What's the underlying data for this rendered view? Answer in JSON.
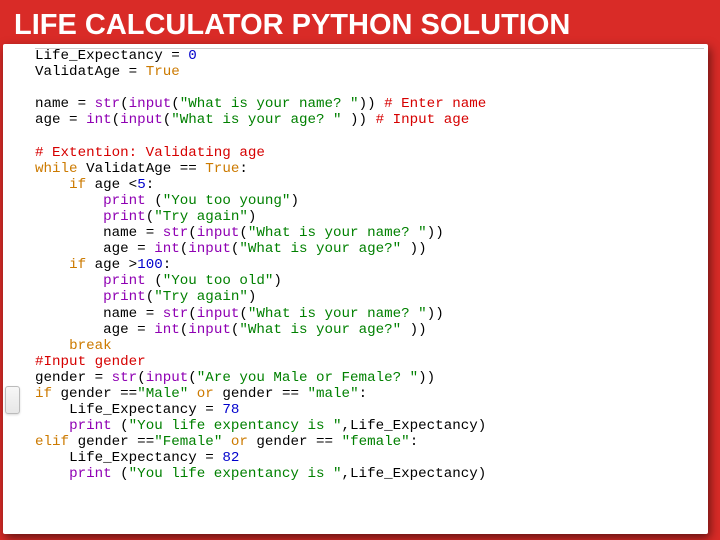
{
  "slide": {
    "title": "LIFE CALCULATOR PYTHON SOLUTION"
  },
  "code": {
    "lines": [
      [
        [
          "name",
          "Life_Expectancy"
        ],
        [
          "op",
          " = "
        ],
        [
          "num",
          "0"
        ]
      ],
      [
        [
          "name",
          "ValidatAge"
        ],
        [
          "op",
          " = "
        ],
        [
          "kw",
          "True"
        ]
      ],
      [],
      [
        [
          "name",
          "name"
        ],
        [
          "op",
          " = "
        ],
        [
          "fn",
          "str"
        ],
        [
          "op",
          "("
        ],
        [
          "fn",
          "input"
        ],
        [
          "op",
          "("
        ],
        [
          "str",
          "\"What is your name? \""
        ],
        [
          "op",
          "))"
        ],
        [
          "op",
          " "
        ],
        [
          "com",
          "# Enter name"
        ]
      ],
      [
        [
          "name",
          "age"
        ],
        [
          "op",
          " = "
        ],
        [
          "fn",
          "int"
        ],
        [
          "op",
          "("
        ],
        [
          "fn",
          "input"
        ],
        [
          "op",
          "("
        ],
        [
          "str",
          "\"What is your age? \""
        ],
        [
          "op",
          " ))"
        ],
        [
          "op",
          " "
        ],
        [
          "com",
          "# Input age"
        ]
      ],
      [],
      [
        [
          "com",
          "# Extention: Validating age"
        ]
      ],
      [
        [
          "kw",
          "while"
        ],
        [
          "op",
          " "
        ],
        [
          "name",
          "ValidatAge"
        ],
        [
          "op",
          " == "
        ],
        [
          "kw",
          "True"
        ],
        [
          "op",
          ":"
        ]
      ],
      [
        [
          "op",
          "    "
        ],
        [
          "kw",
          "if"
        ],
        [
          "op",
          " "
        ],
        [
          "name",
          "age"
        ],
        [
          "op",
          " <"
        ],
        [
          "num",
          "5"
        ],
        [
          "op",
          ":"
        ]
      ],
      [
        [
          "op",
          "        "
        ],
        [
          "fn",
          "print"
        ],
        [
          "op",
          " ("
        ],
        [
          "str",
          "\"You too young\""
        ],
        [
          "op",
          ")"
        ]
      ],
      [
        [
          "op",
          "        "
        ],
        [
          "fn",
          "print"
        ],
        [
          "op",
          "("
        ],
        [
          "str",
          "\"Try again\""
        ],
        [
          "op",
          ")"
        ]
      ],
      [
        [
          "op",
          "        "
        ],
        [
          "name",
          "name"
        ],
        [
          "op",
          " = "
        ],
        [
          "fn",
          "str"
        ],
        [
          "op",
          "("
        ],
        [
          "fn",
          "input"
        ],
        [
          "op",
          "("
        ],
        [
          "str",
          "\"What is your name? \""
        ],
        [
          "op",
          "))"
        ]
      ],
      [
        [
          "op",
          "        "
        ],
        [
          "name",
          "age"
        ],
        [
          "op",
          " = "
        ],
        [
          "fn",
          "int"
        ],
        [
          "op",
          "("
        ],
        [
          "fn",
          "input"
        ],
        [
          "op",
          "("
        ],
        [
          "str",
          "\"What is your age?\""
        ],
        [
          "op",
          " ))"
        ]
      ],
      [
        [
          "op",
          "    "
        ],
        [
          "kw",
          "if"
        ],
        [
          "op",
          " "
        ],
        [
          "name",
          "age"
        ],
        [
          "op",
          " >"
        ],
        [
          "num",
          "100"
        ],
        [
          "op",
          ":"
        ]
      ],
      [
        [
          "op",
          "        "
        ],
        [
          "fn",
          "print"
        ],
        [
          "op",
          " ("
        ],
        [
          "str",
          "\"You too old\""
        ],
        [
          "op",
          ")"
        ]
      ],
      [
        [
          "op",
          "        "
        ],
        [
          "fn",
          "print"
        ],
        [
          "op",
          "("
        ],
        [
          "str",
          "\"Try again\""
        ],
        [
          "op",
          ")"
        ]
      ],
      [
        [
          "op",
          "        "
        ],
        [
          "name",
          "name"
        ],
        [
          "op",
          " = "
        ],
        [
          "fn",
          "str"
        ],
        [
          "op",
          "("
        ],
        [
          "fn",
          "input"
        ],
        [
          "op",
          "("
        ],
        [
          "str",
          "\"What is your name? \""
        ],
        [
          "op",
          "))"
        ]
      ],
      [
        [
          "op",
          "        "
        ],
        [
          "name",
          "age"
        ],
        [
          "op",
          " = "
        ],
        [
          "fn",
          "int"
        ],
        [
          "op",
          "("
        ],
        [
          "fn",
          "input"
        ],
        [
          "op",
          "("
        ],
        [
          "str",
          "\"What is your age?\""
        ],
        [
          "op",
          " ))"
        ]
      ],
      [
        [
          "op",
          "    "
        ],
        [
          "kw",
          "break"
        ]
      ],
      [
        [
          "com",
          "#Input gender"
        ]
      ],
      [
        [
          "name",
          "gender"
        ],
        [
          "op",
          " = "
        ],
        [
          "fn",
          "str"
        ],
        [
          "op",
          "("
        ],
        [
          "fn",
          "input"
        ],
        [
          "op",
          "("
        ],
        [
          "str",
          "\"Are you Male or Female? \""
        ],
        [
          "op",
          "))"
        ]
      ],
      [
        [
          "kw",
          "if"
        ],
        [
          "op",
          " "
        ],
        [
          "name",
          "gender"
        ],
        [
          "op",
          " =="
        ],
        [
          "str",
          "\"Male\""
        ],
        [
          "op",
          " "
        ],
        [
          "kw",
          "or"
        ],
        [
          "op",
          " "
        ],
        [
          "name",
          "gender"
        ],
        [
          "op",
          " == "
        ],
        [
          "str",
          "\"male\""
        ],
        [
          "op",
          ":"
        ]
      ],
      [
        [
          "op",
          "    "
        ],
        [
          "name",
          "Life_Expectancy"
        ],
        [
          "op",
          " = "
        ],
        [
          "num",
          "78"
        ]
      ],
      [
        [
          "op",
          "    "
        ],
        [
          "fn",
          "print"
        ],
        [
          "op",
          " ("
        ],
        [
          "str",
          "\"You life expentancy is \""
        ],
        [
          "op",
          ","
        ],
        [
          "name",
          "Life_Expectancy"
        ],
        [
          "op",
          ")"
        ]
      ],
      [
        [
          "kw",
          "elif"
        ],
        [
          "op",
          " "
        ],
        [
          "name",
          "gender"
        ],
        [
          "op",
          " =="
        ],
        [
          "str",
          "\"Female\""
        ],
        [
          "op",
          " "
        ],
        [
          "kw",
          "or"
        ],
        [
          "op",
          " "
        ],
        [
          "name",
          "gender"
        ],
        [
          "op",
          " == "
        ],
        [
          "str",
          "\"female\""
        ],
        [
          "op",
          ":"
        ]
      ],
      [
        [
          "op",
          "    "
        ],
        [
          "name",
          "Life_Expectancy"
        ],
        [
          "op",
          " = "
        ],
        [
          "num",
          "82"
        ]
      ],
      [
        [
          "op",
          "    "
        ],
        [
          "fn",
          "print"
        ],
        [
          "op",
          " ("
        ],
        [
          "str",
          "\"You life expentancy is \""
        ],
        [
          "op",
          ","
        ],
        [
          "name",
          "Life_Expectancy"
        ],
        [
          "op",
          ")"
        ]
      ]
    ]
  }
}
